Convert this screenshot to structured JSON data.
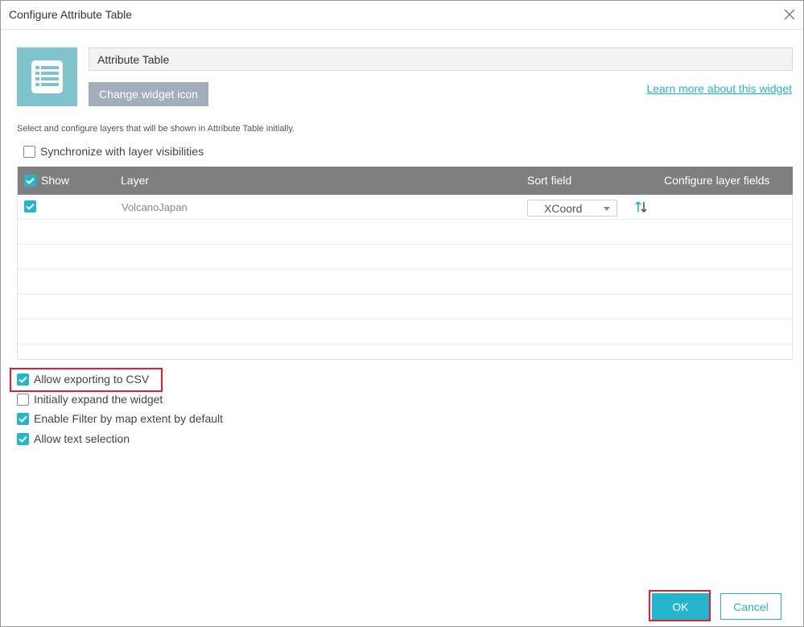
{
  "dialog": {
    "title": "Configure Attribute Table",
    "close_icon": "close-icon"
  },
  "widget": {
    "icon": "table-list-icon",
    "name_value": "Attribute Table",
    "change_icon_label": "Change widget icon",
    "learn_more_label": "Learn more about this widget"
  },
  "layers_section": {
    "description": "Select and configure layers that will be shown in Attribute Table initially.",
    "sync_label": "Synchronize with layer visibilities",
    "sync_checked": false
  },
  "table": {
    "headers": {
      "show": "Show",
      "layer": "Layer",
      "sort_field": "Sort field",
      "configure": "Configure layer fields"
    },
    "rows": [
      {
        "show": true,
        "layer": "VolcanoJapan",
        "sort_field": "XCoord",
        "sort_icon": "sort-asc-desc-icon"
      }
    ]
  },
  "options": [
    {
      "label": "Allow exporting to CSV",
      "checked": true
    },
    {
      "label": "Initially expand the widget",
      "checked": false
    },
    {
      "label": "Enable Filter by map extent by default",
      "checked": true
    },
    {
      "label": "Allow text selection",
      "checked": true
    }
  ],
  "footer": {
    "ok_label": "OK",
    "cancel_label": "Cancel"
  },
  "colors": {
    "accent": "#24b5cc",
    "header_bg": "#7f7f7f",
    "icon_bg": "#7fc3cd",
    "highlight": "#e0202a"
  }
}
